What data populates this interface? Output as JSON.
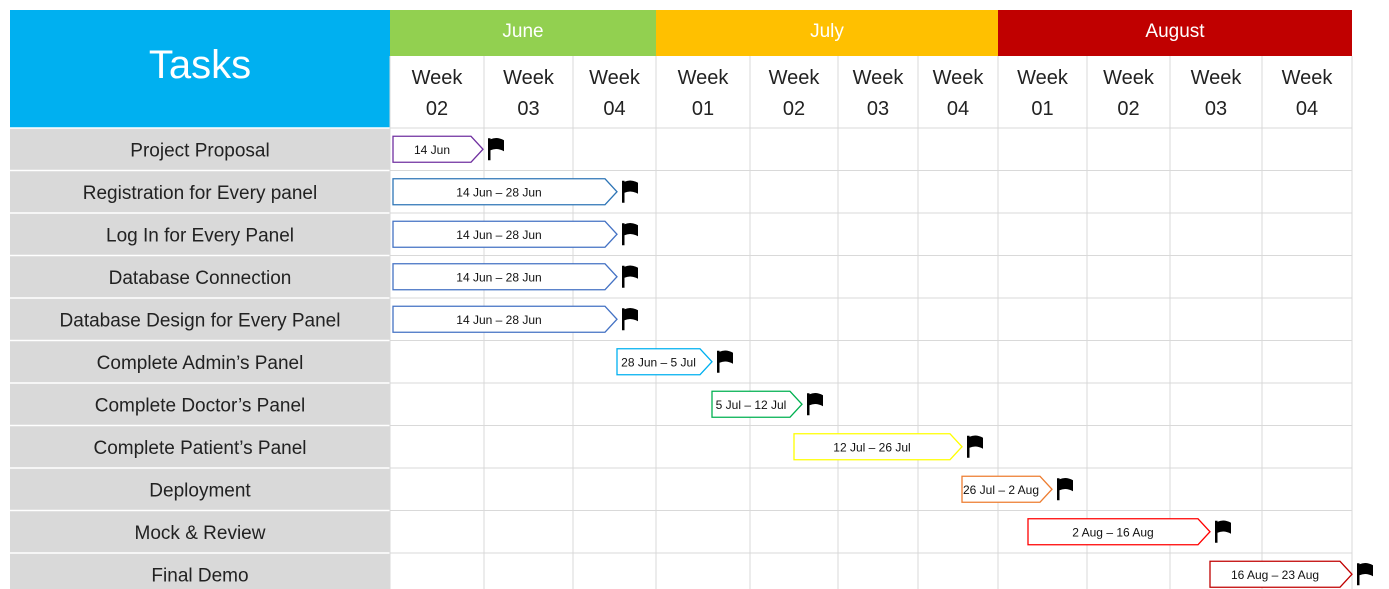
{
  "chart_data": {
    "type": "gantt",
    "header_title": "Tasks",
    "months": [
      {
        "label": "June",
        "color": "#92d050",
        "weeks": 3
      },
      {
        "label": "July",
        "color": "#ffc000",
        "weeks": 4
      },
      {
        "label": "August",
        "color": "#c00000",
        "weeks": 4
      }
    ],
    "weeks": [
      {
        "l1": "Week",
        "l2": "02"
      },
      {
        "l1": "Week",
        "l2": "03"
      },
      {
        "l1": "Week",
        "l2": "04"
      },
      {
        "l1": "Week",
        "l2": "01"
      },
      {
        "l1": "Week",
        "l2": "02"
      },
      {
        "l1": "Week",
        "l2": "03"
      },
      {
        "l1": "Week",
        "l2": "04"
      },
      {
        "l1": "Week",
        "l2": "01"
      },
      {
        "l1": "Week",
        "l2": "02"
      },
      {
        "l1": "Week",
        "l2": "03"
      },
      {
        "l1": "Week",
        "l2": "04"
      }
    ],
    "tasks": [
      {
        "name": "Project Proposal",
        "start": "2023-06-14",
        "end": "2023-06-14",
        "label": "14 Jun",
        "color": "#7030a0"
      },
      {
        "name": "Registration for Every panel",
        "start": "2023-06-14",
        "end": "2023-06-28",
        "label": "14 Jun – 28 Jun",
        "color": "#2e75b6"
      },
      {
        "name": "Log In for Every Panel",
        "start": "2023-06-14",
        "end": "2023-06-28",
        "label": "14 Jun – 28 Jun",
        "color": "#4472c4"
      },
      {
        "name": "Database Connection",
        "start": "2023-06-14",
        "end": "2023-06-28",
        "label": "14 Jun – 28 Jun",
        "color": "#4472c4"
      },
      {
        "name": "Database Design for Every Panel",
        "start": "2023-06-14",
        "end": "2023-06-28",
        "label": "14 Jun – 28 Jun",
        "color": "#4472c4"
      },
      {
        "name": "Complete Admin’s Panel",
        "start": "2023-06-28",
        "end": "2023-07-05",
        "label": "28 Jun – 5 Jul",
        "color": "#00b0f0"
      },
      {
        "name": "Complete Doctor’s Panel",
        "start": "2023-07-05",
        "end": "2023-07-12",
        "label": "5 Jul – 12 Jul",
        "color": "#00b050"
      },
      {
        "name": "Complete Patient’s Panel",
        "start": "2023-07-12",
        "end": "2023-07-26",
        "label": "12 Jul – 26 Jul",
        "color": "#ffff00"
      },
      {
        "name": "Deployment",
        "start": "2023-07-26",
        "end": "2023-08-02",
        "label": "26 Jul – 2 Aug",
        "color": "#ed7d31"
      },
      {
        "name": "Mock & Review",
        "start": "2023-08-02",
        "end": "2023-08-16",
        "label": "2 Aug – 16 Aug",
        "color": "#ff0000"
      },
      {
        "name": "Final Demo",
        "start": "2023-08-16",
        "end": "2023-08-23",
        "label": "16 Aug – 23 Aug",
        "color": "#c00000"
      }
    ],
    "milestone_icon": "flag-icon"
  }
}
